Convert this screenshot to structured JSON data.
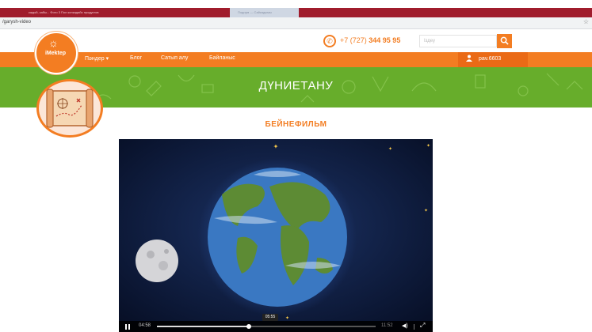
{
  "browser": {
    "active_tab_title": "кадый, кабы... Фото 3 Пол конкадайс продуктов",
    "inactive_tab_title": "Подиум — Сайкадымы",
    "url": "/garysh-video",
    "star_icon": "star-icon"
  },
  "header": {
    "logo_text": "iMektep",
    "phone_prefix": "+7 (727) ",
    "phone_number": "344 95 95",
    "search_placeholder": "Іздеу",
    "search_icon": "search-icon"
  },
  "nav": {
    "items": [
      {
        "label": "Пәндер ▾"
      },
      {
        "label": "Блог"
      },
      {
        "label": "Сатып алу"
      },
      {
        "label": "Байланыс"
      }
    ],
    "user": "pav.6603"
  },
  "banner": {
    "title": "ДҮНИЕТАНУ"
  },
  "section": {
    "title": "БЕЙНЕФИЛЬМ"
  },
  "player": {
    "current_time": "04:58",
    "duration": "11:52",
    "hover_time": "05:55",
    "progress": 0.42,
    "colors": {
      "background": "#0c1a3b",
      "ocean": "#3a78c2",
      "land": "#5d8b34"
    }
  },
  "colors": {
    "accent": "#f37d22",
    "banner": "#67ad2b",
    "browser_tab": "#a01c2c"
  }
}
